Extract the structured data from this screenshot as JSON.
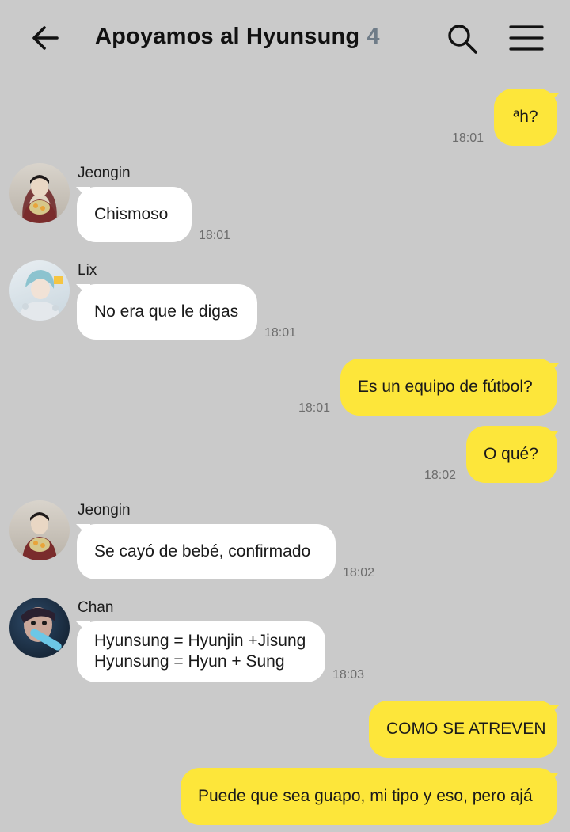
{
  "header": {
    "title": "Apoyamos al Hyunsung",
    "member_count": "4",
    "back_icon": "arrow-left-icon",
    "search_icon": "search-icon",
    "menu_icon": "hamburger-menu-icon"
  },
  "colors": {
    "background": "#cacaca",
    "outgoing_bubble": "#fde63a",
    "incoming_bubble": "#ffffff",
    "count_gray": "#6f7c88"
  },
  "messages": [
    {
      "direction": "out",
      "text": "ªh?",
      "time": "18:01"
    },
    {
      "direction": "in",
      "sender": "Jeongin",
      "text": "Chismoso",
      "time": "18:01"
    },
    {
      "direction": "in",
      "sender": "Lix",
      "text": "No era que le digas",
      "time": "18:01"
    },
    {
      "direction": "out",
      "text": "Es un equipo de fútbol?",
      "time": "18:01"
    },
    {
      "direction": "out",
      "text": "O qué?",
      "time": "18:02"
    },
    {
      "direction": "in",
      "sender": "Jeongin",
      "text": "Se cayó de bebé, confirmado",
      "time": "18:02"
    },
    {
      "direction": "in",
      "sender": "Chan",
      "text": "Hyunsung = Hyunjin +Jisung\nHyunsung = Hyun + Sung",
      "time": "18:03"
    },
    {
      "direction": "out",
      "text": "COMO SE ATREVEN",
      "time": ""
    },
    {
      "direction": "out",
      "text": "Puede que sea guapo, mi tipo y eso, pero ajá",
      "time": ""
    }
  ]
}
